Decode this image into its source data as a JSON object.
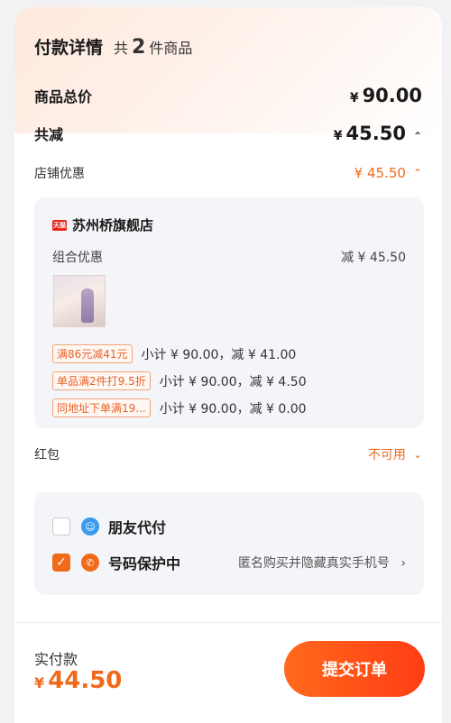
{
  "header": {
    "title": "付款详情",
    "count_prefix": "共",
    "count": "2",
    "count_suffix": "件商品"
  },
  "summary": {
    "total_label": "商品总价",
    "total_currency": "¥",
    "total_value": "90.00",
    "discount_label": "共减",
    "discount_currency": "¥",
    "discount_value": "45.50"
  },
  "store_discount": {
    "label": "店铺优惠",
    "value": "¥ 45.50"
  },
  "shop": {
    "logo_text": "天猫",
    "name": "苏州桥旗舰店",
    "combo_label": "组合优惠",
    "combo_value": "减 ¥ 45.50",
    "promotions": [
      {
        "tag": "满86元减41元",
        "text": "小计 ¥ 90.00，减 ¥ 41.00"
      },
      {
        "tag": "单品满2件打9.5折",
        "text": "小计 ¥ 90.00，减 ¥ 4.50"
      },
      {
        "tag": "同地址下单满19...",
        "text": "小计 ¥ 90.00，减 ¥ 0.00"
      }
    ]
  },
  "red_packet": {
    "label": "红包",
    "value": "不可用"
  },
  "options": {
    "friend_pay": {
      "label": "朋友代付",
      "checked": false,
      "icon_color": "#3a9bf0"
    },
    "number_protect": {
      "label": "号码保护中",
      "desc": "匿名购买并隐藏真实手机号",
      "checked": true,
      "icon_color": "#f06a1a"
    }
  },
  "footer": {
    "pay_label": "实付款",
    "pay_currency": "¥",
    "pay_value": "44.50",
    "submit_label": "提交订单"
  },
  "colors": {
    "accent": "#f06a1a",
    "card_bg": "#f3f5f8"
  }
}
